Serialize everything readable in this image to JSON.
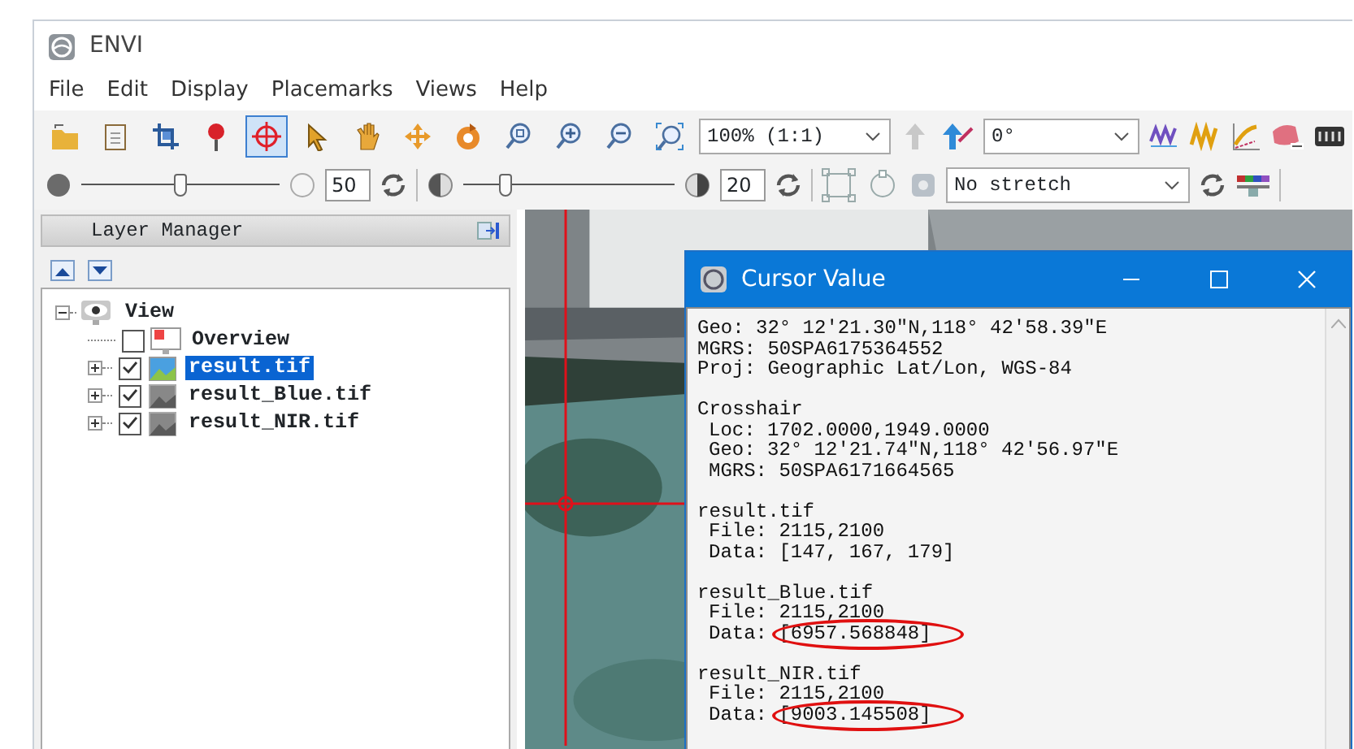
{
  "window": {
    "title": "ENVI"
  },
  "menu": [
    "File",
    "Edit",
    "Display",
    "Placemarks",
    "Views",
    "Help"
  ],
  "toolbar": {
    "tools": [
      {
        "selected": false
      },
      {
        "selected": false
      },
      {
        "selected": false
      },
      {
        "selected": false
      },
      {
        "selected": true
      },
      {
        "selected": false
      },
      {
        "selected": false
      },
      {
        "selected": false
      },
      {
        "selected": false
      },
      {
        "selected": false
      },
      {
        "selected": false
      },
      {
        "selected": false
      },
      {
        "selected": false
      }
    ],
    "zoom": "100% (1:1)",
    "rotation": "0°"
  },
  "display_bar": {
    "brightness": {
      "level": 0.5,
      "value": "50"
    },
    "contrast": {
      "level": 0.2,
      "value": "20"
    },
    "stretch": "No stretch"
  },
  "layer_manager": {
    "title": "Layer Manager",
    "tree": {
      "label": "View",
      "expanded": true,
      "children": [
        {
          "label": "Overview",
          "kind": "overview",
          "checked": false,
          "selected": false
        },
        {
          "label": "result.tif",
          "kind": "color",
          "checked": true,
          "selected": true,
          "expanded": false
        },
        {
          "label": "result_Blue.tif",
          "kind": "gray",
          "checked": true,
          "selected": false,
          "expanded": false
        },
        {
          "label": "result_NIR.tif",
          "kind": "gray",
          "checked": true,
          "selected": false,
          "expanded": false
        }
      ]
    }
  },
  "cursor_value": {
    "title": "Cursor Value",
    "sections": [
      {
        "lines": [
          {
            "text": "Geo: 32° 12′21.30″N,118° 42′58.39″E"
          },
          {
            "text": "MGRS: 50SPA6175364552"
          },
          {
            "text": "Proj: Geographic Lat/Lon, WGS-84"
          }
        ]
      },
      {
        "heading": "Crosshair",
        "lines": [
          {
            "text": "Loc: 1702.0000,1949.0000"
          },
          {
            "text": "Geo: 32° 12′21.74″N,118° 42′56.97″E"
          },
          {
            "text": "MGRS: 50SPA6171664565"
          }
        ]
      },
      {
        "heading": "result.tif",
        "lines": [
          {
            "text": "File: 2115,2100"
          },
          {
            "text": "Data: [147, 167, 179]"
          }
        ]
      },
      {
        "heading": "result_Blue.tif",
        "lines": [
          {
            "text": "File: 2115,2100"
          },
          {
            "text": "Data: [6957.568848]",
            "circled": true
          }
        ]
      },
      {
        "heading": "result_NIR.tif",
        "lines": [
          {
            "text": "File: 2115,2100"
          },
          {
            "text": "Data: [9003.145508]",
            "circled": true
          }
        ]
      }
    ]
  }
}
